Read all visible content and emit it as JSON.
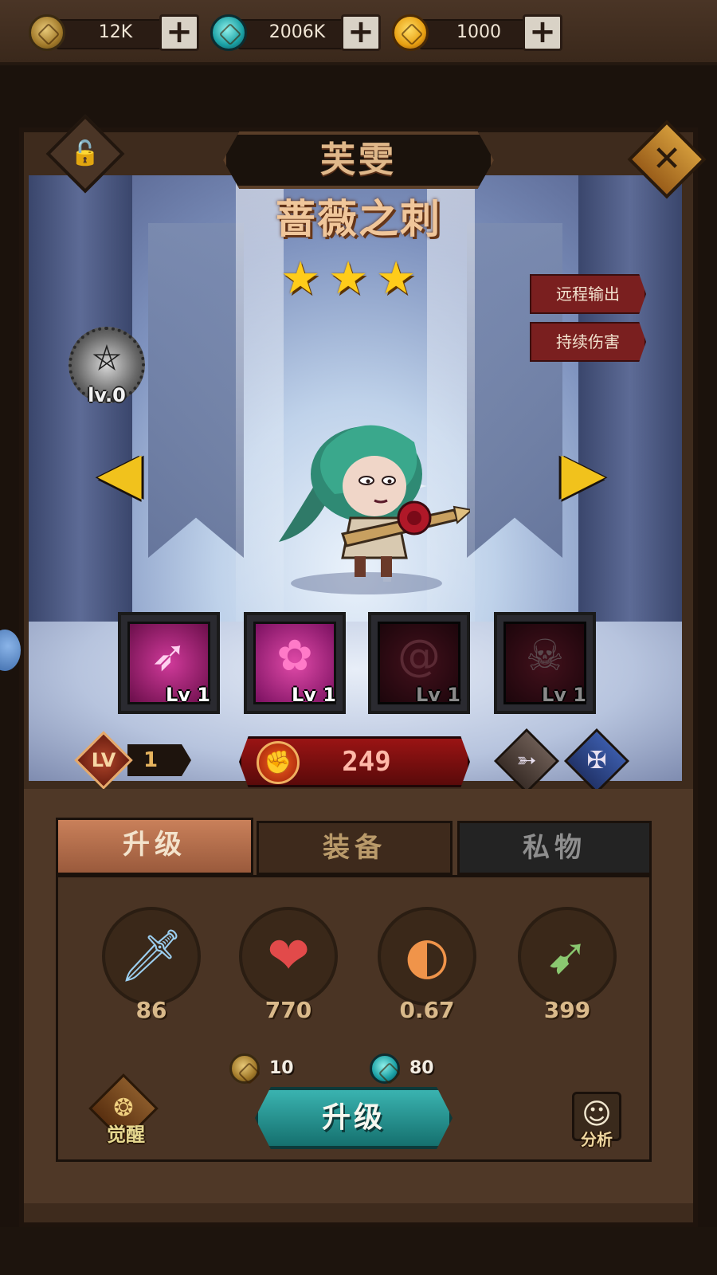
{
  "currencies": [
    {
      "icon": "coin-icon",
      "value": "12K",
      "add_label": "+"
    },
    {
      "icon": "gem-icon",
      "value": "2006K",
      "add_label": "+"
    },
    {
      "icon": "gold-token-icon",
      "value": "1000",
      "add_label": "+"
    }
  ],
  "hero": {
    "name": "芙雯",
    "title": "蔷薇之刺",
    "stars": 3,
    "tags": [
      "远程输出",
      "持续伤害"
    ],
    "rune_level": "lv.0",
    "level_icon": "LV",
    "level": "1",
    "power": "249"
  },
  "skills": [
    {
      "icon": "arrow-strike-icon",
      "level": "Lv 1",
      "unlocked": true
    },
    {
      "icon": "rose-icon",
      "level": "Lv 1",
      "unlocked": true
    },
    {
      "icon": "thorn-swirl-icon",
      "level": "Lv 1",
      "unlocked": false
    },
    {
      "icon": "skull-icon",
      "level": "Lv 1",
      "unlocked": false
    }
  ],
  "tabs": {
    "upgrade": "升级",
    "equip": "装备",
    "private": "私物"
  },
  "stats": [
    {
      "icon": "sword-icon",
      "value": "86"
    },
    {
      "icon": "heart-icon",
      "value": "770"
    },
    {
      "icon": "attack-speed-icon",
      "value": "0.67"
    },
    {
      "icon": "arrow-range-icon",
      "value": "399"
    }
  ],
  "upgrade_cost": {
    "coin": "10",
    "gem": "80"
  },
  "buttons": {
    "upgrade": "升级",
    "awaken": "觉醒",
    "analyze": "分析"
  },
  "colors": {
    "accent_teal": "#1a8c8a",
    "power_red": "#8a1010",
    "star_gold": "#ffcc1a"
  }
}
